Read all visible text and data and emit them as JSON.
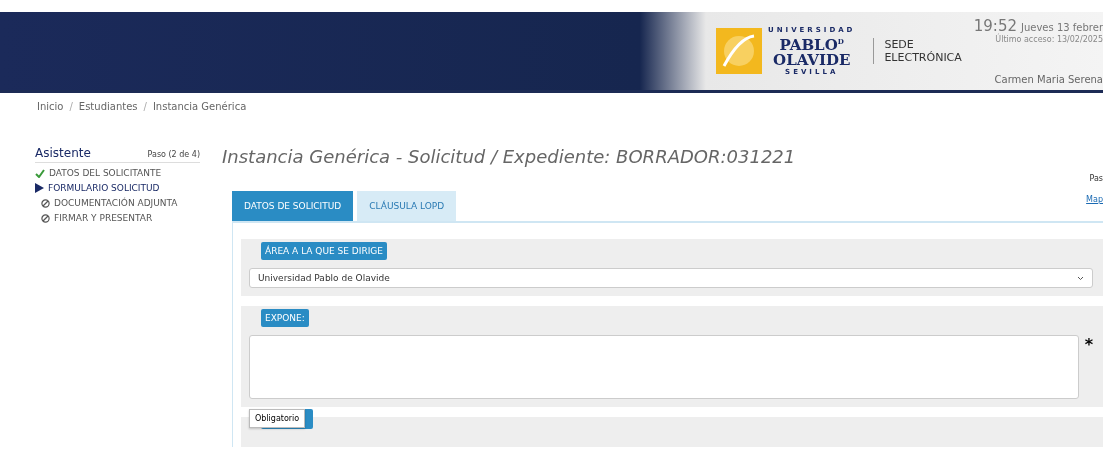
{
  "header": {
    "logo": {
      "top": "UNIVERSIDAD",
      "name_1": "PABLO",
      "name_de": "D",
      "name_2": "OLAVIDE",
      "bottom": "SEVILLA"
    },
    "portal": [
      "SEDE",
      "ELECTRÓNICA"
    ],
    "time": "19:52",
    "date": "Jueves 13 febrer",
    "last_access": "Último acceso: 13/02/2025",
    "user": "Carmen Maria Serena"
  },
  "breadcrumb": [
    "Inicio",
    "Estudiantes",
    "Instancia Genérica"
  ],
  "breadcrumb_separator": "/",
  "wizard": {
    "title": "Asistente",
    "step": "Paso (2 de 4)",
    "steps": [
      {
        "label": "DATOS DEL SOLICITANTE",
        "completed": true,
        "selected": false
      },
      {
        "label": "FORMULARIO SOLICITUD",
        "completed": false,
        "selected": true
      },
      {
        "label": "DOCUMENTACIÓN ADJUNTA",
        "completed": false,
        "selected": false
      },
      {
        "label": "FIRMAR Y PRESENTAR",
        "completed": false,
        "selected": false
      }
    ]
  },
  "page_title": "Instancia Genérica - Solicitud / Expediente: BORRADOR:031221",
  "side_text": "Pas",
  "side_link": "Map",
  "tabs": [
    {
      "label": "DATOS DE SOLICITUD",
      "selected": true
    },
    {
      "label": "CLÁUSULA LOPD",
      "selected": false
    }
  ],
  "sections": [
    {
      "kind": "select",
      "label": "ÁREA A LA QUE SE DIRIGE",
      "value": "Universidad Pablo de Olavide"
    },
    {
      "kind": "textarea",
      "label": "EXPONE:",
      "required": true,
      "required_mark": "*",
      "tooltip": "Obligatorio"
    },
    {
      "kind": "hidden_label"
    }
  ]
}
